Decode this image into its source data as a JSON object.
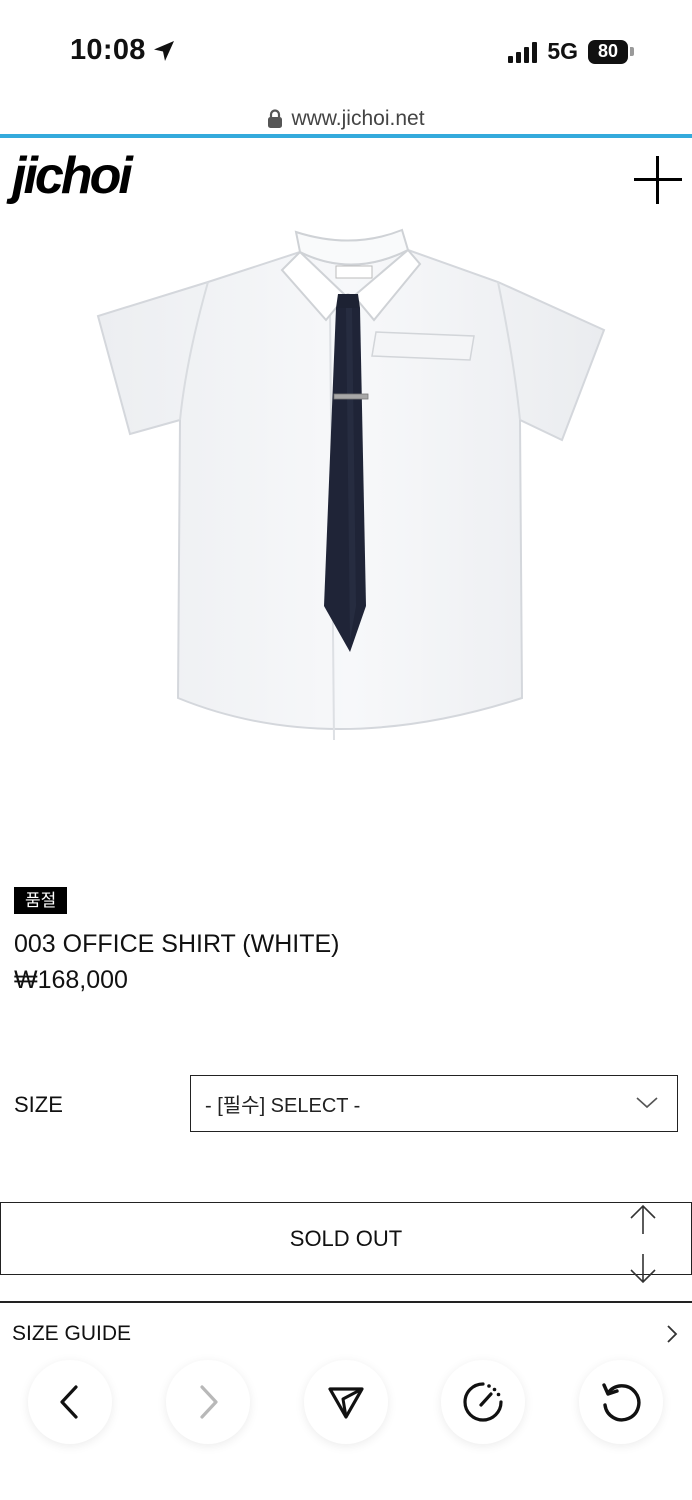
{
  "status_bar": {
    "time": "10:08",
    "network": "5G",
    "battery": "80"
  },
  "browser": {
    "url": "www.jichoi.net"
  },
  "site": {
    "logo": "jichoi"
  },
  "product": {
    "badge": "품절",
    "name": "003 OFFICE SHIRT (WHITE)",
    "price": "₩168,000"
  },
  "options": {
    "size_label": "SIZE",
    "size_select_value": "- [필수] SELECT -"
  },
  "actions": {
    "soldout_label": "SOLD OUT"
  },
  "sections": {
    "size_guide_label": "SIZE GUIDE"
  },
  "toolbar": {
    "icons": [
      "back-icon",
      "forward-icon",
      "share-icon",
      "speed-dial-icon",
      "refresh-icon"
    ]
  },
  "colors": {
    "url_progress": "#34aadc",
    "text": "#111111",
    "badge_bg": "#000000"
  }
}
